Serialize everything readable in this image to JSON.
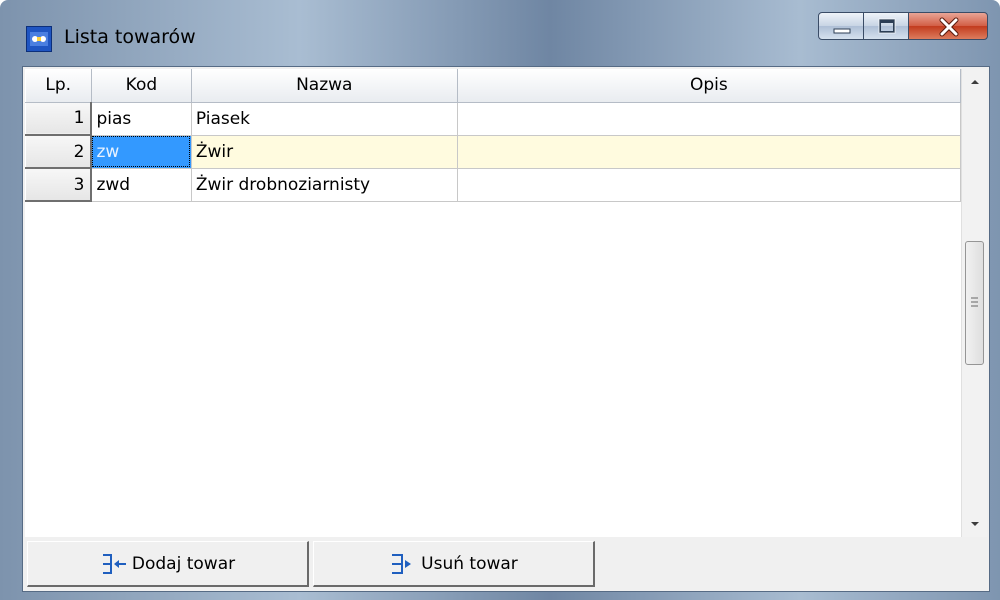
{
  "window": {
    "title": "Lista towarów",
    "icon": "app-logo-icon"
  },
  "grid": {
    "columns": [
      "Lp.",
      "Kod",
      "Nazwa",
      "Opis"
    ],
    "rows": [
      {
        "lp": "1",
        "kod": "pias",
        "nazwa": "Piasek",
        "opis": ""
      },
      {
        "lp": "2",
        "kod": "zw",
        "nazwa": "Żwir",
        "opis": ""
      },
      {
        "lp": "3",
        "kod": "zwd",
        "nazwa": "Żwir drobnoziarnisty",
        "opis": ""
      }
    ],
    "selected_row": 2
  },
  "toolbar": {
    "add_label": "Dodaj towar",
    "remove_label": "Usuń towar"
  },
  "colors": {
    "selection": "#3399ff",
    "selected_row": "#fffbdf",
    "close_button": "#c23b1e"
  }
}
